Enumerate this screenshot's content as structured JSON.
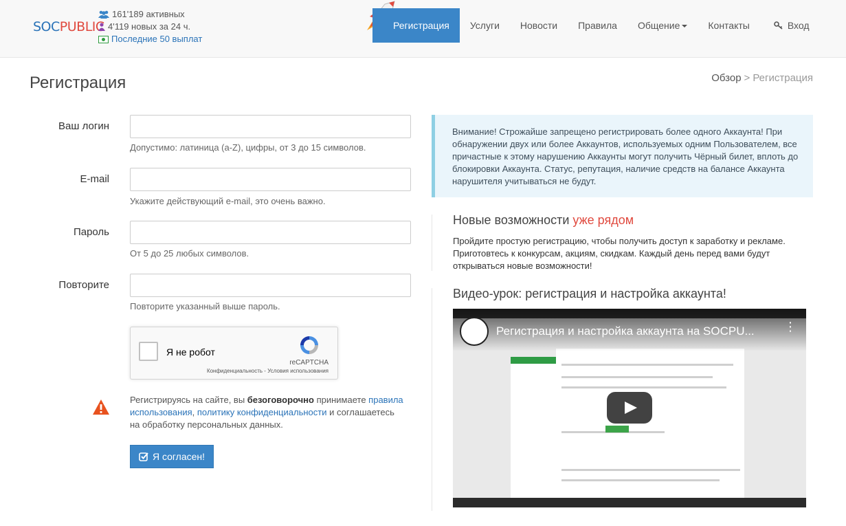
{
  "header": {
    "logo": {
      "soc": "SOC",
      "pub": "PUBLIC"
    },
    "stats": {
      "active": "161'189 активных",
      "new": "4'119 новых за 24 ч.",
      "payouts": "Последние 50 выплат"
    },
    "nav": {
      "register": "Регистрация",
      "services": "Услуги",
      "news": "Новости",
      "rules": "Правила",
      "community": "Общение",
      "contacts": "Контакты",
      "login": "Вход"
    }
  },
  "page": {
    "title": "Регистрация",
    "breadcrumb": {
      "root": "Обзор",
      "sep": ">",
      "current": "Регистрация"
    }
  },
  "form": {
    "login": {
      "label": "Ваш логин",
      "value": "",
      "help": "Допустимо: латиница (a-Z), цифры, от 3 до 15 символов."
    },
    "email": {
      "label": "E-mail",
      "value": "",
      "help": "Укажите действующий e-mail, это очень важно."
    },
    "password": {
      "label": "Пароль",
      "value": "",
      "help": "От 5 до 25 любых символов."
    },
    "repeat": {
      "label": "Повторите",
      "value": "",
      "help": "Повторите указанный выше пароль."
    },
    "recaptcha": {
      "label": "Я не робот",
      "brand": "reCAPTCHA",
      "links": "Конфиденциальность - Условия использования"
    },
    "terms": {
      "part1": "Регистрируясь на сайте, вы ",
      "bold": "безоговорочно",
      "part2": " принимаете ",
      "link1": "правила использования",
      "comma": ", ",
      "link2": "политику конфиденциальности",
      "part3": " и соглашаетесь на обработку персональных данных."
    },
    "agree_button": "Я согласен!"
  },
  "alert": {
    "text": "Внимание! Строжайше запрещено регистрировать более одного Аккаунта! При обнаружении двух или более Аккаунтов, используемых одним Пользователем, все причастные к этому нарушению Аккаунты могут получить Чёрный билет, вплоть до блокировки Аккаунта. Статус, репутация, наличие средств на балансе Аккаунта нарушителя учитываться не будут."
  },
  "features": {
    "title": "Новые возможности ",
    "title_accent": "уже рядом",
    "text": "Пройдите простую регистрацию, чтобы получить доступ к заработку и рекламе. Приготовтесь к конкурсам, акциям, скидкам. Каждый день перед вами будут открываться новые возможности!"
  },
  "video": {
    "section_title": "Видео-урок: регистрация и настройка аккаунта!",
    "title": "Регистрация и настройка аккаунта на SOCPU..."
  },
  "colors": {
    "accent": "#3b86c8",
    "brand_red": "#e04a3f",
    "alert_bg": "#eaf5fb",
    "alert_border": "#8ecfe3"
  }
}
